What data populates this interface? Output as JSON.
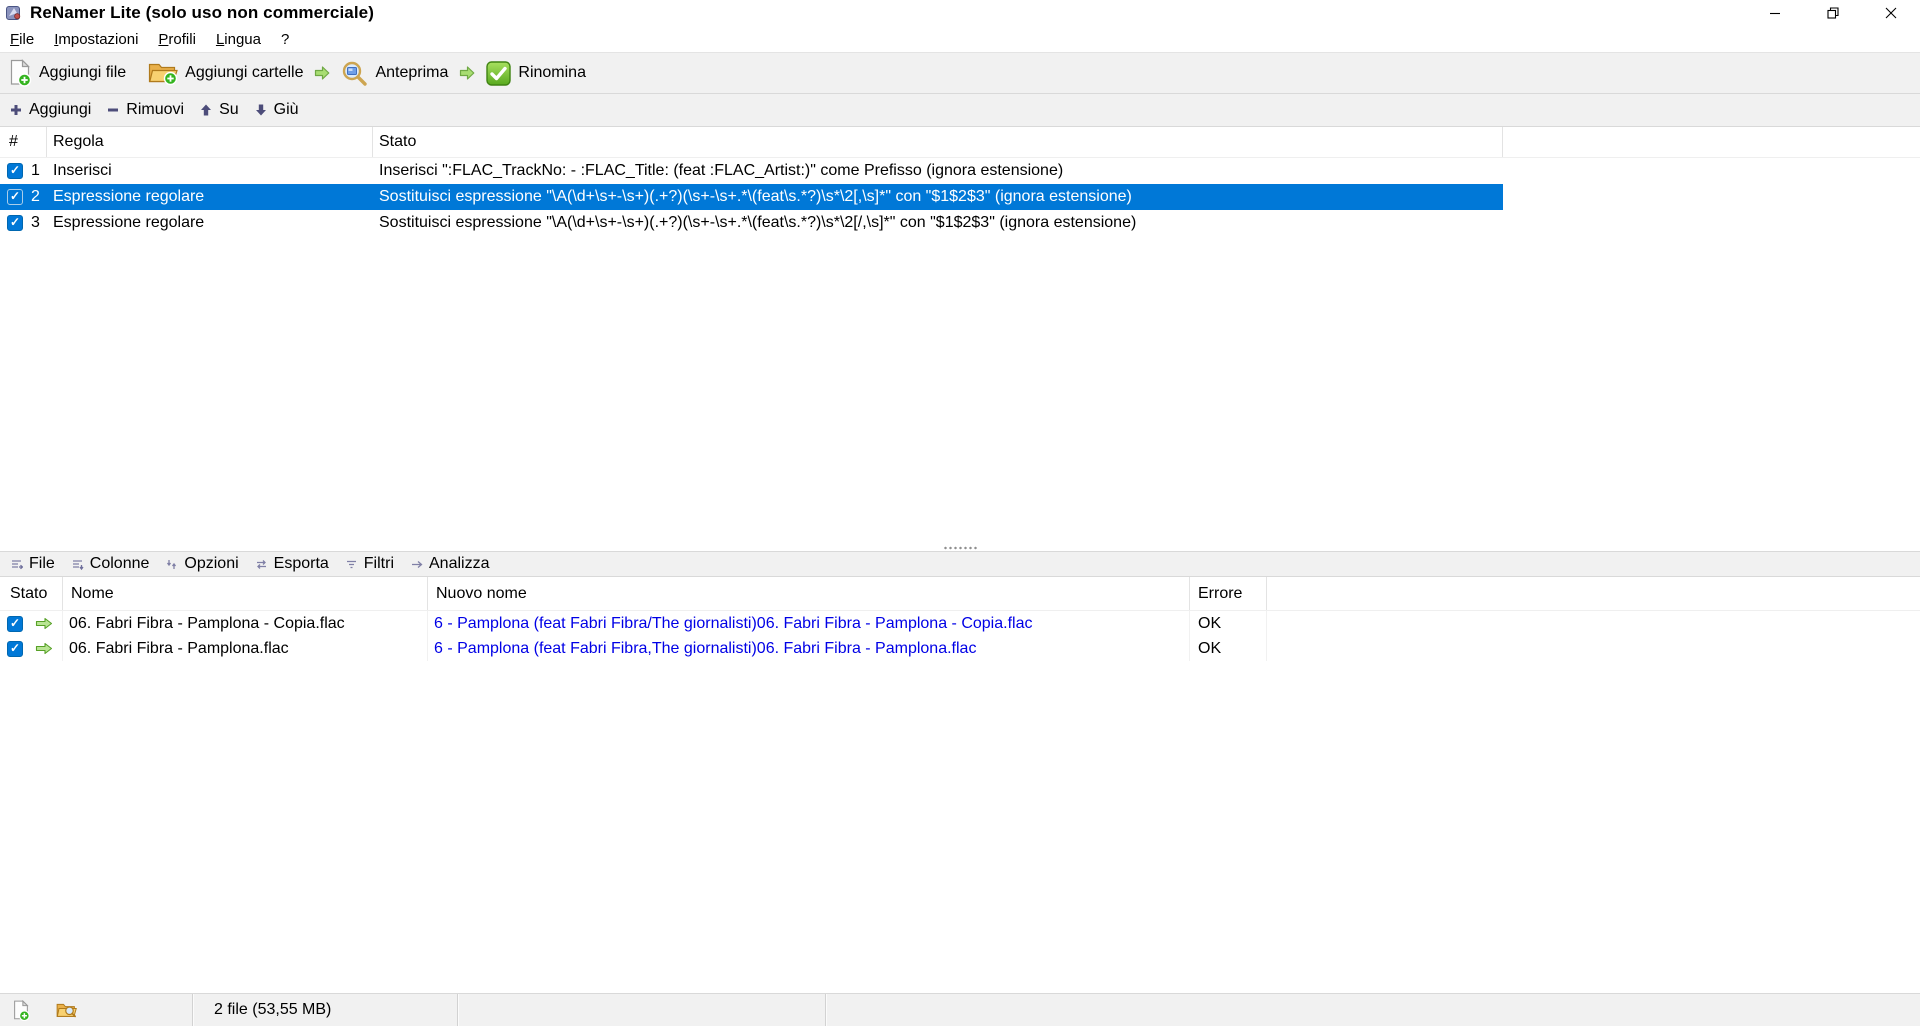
{
  "window": {
    "title": "ReNamer Lite (solo uso non commerciale)"
  },
  "menu": {
    "items": [
      "File",
      "Impostazioni",
      "Profili",
      "Lingua",
      "?"
    ]
  },
  "toolbar": {
    "add_files": "Aggiungi file",
    "add_folders": "Aggiungi cartelle",
    "preview": "Anteprima",
    "rename": "Rinomina"
  },
  "rules_toolbar": {
    "add": "Aggiungi",
    "remove": "Rimuovi",
    "up": "Su",
    "down": "Giù"
  },
  "rules_table": {
    "columns": {
      "num": "#",
      "rule": "Regola",
      "status": "Stato"
    },
    "selected_row": 2,
    "rows": [
      {
        "num": "1",
        "checked": true,
        "rule": "Inserisci",
        "status": "Inserisci \":FLAC_TrackNo: - :FLAC_Title: (feat :FLAC_Artist:)\" come Prefisso (ignora estensione)"
      },
      {
        "num": "2",
        "checked": true,
        "rule": "Espressione regolare",
        "status": "Sostituisci espressione \"\\A(\\d+\\s+-\\s+)(.+?)(\\s+-\\s+.*\\(feat\\s.*?)\\s*\\2[,\\s]*\" con \"$1$2$3\" (ignora estensione)"
      },
      {
        "num": "3",
        "checked": true,
        "rule": "Espressione regolare",
        "status": "Sostituisci espressione \"\\A(\\d+\\s+-\\s+)(.+?)(\\s+-\\s+.*\\(feat\\s.*?)\\s*\\2[/,\\s]*\" con \"$1$2$3\" (ignora estensione)"
      }
    ]
  },
  "files_toolbar": {
    "items": [
      "File",
      "Colonne",
      "Opzioni",
      "Esporta",
      "Filtri",
      "Analizza"
    ]
  },
  "files_table": {
    "columns": {
      "status": "Stato",
      "name": "Nome",
      "new_name": "Nuovo nome",
      "error": "Errore"
    },
    "rows": [
      {
        "checked": true,
        "name": "06. Fabri Fibra - Pamplona - Copia.flac",
        "new_name": "6 - Pamplona (feat Fabri Fibra/The giornalisti)06. Fabri Fibra - Pamplona - Copia.flac",
        "error": "OK"
      },
      {
        "checked": true,
        "name": "06. Fabri Fibra - Pamplona.flac",
        "new_name": "6 - Pamplona (feat Fabri Fibra,The giornalisti)06. Fabri Fibra - Pamplona.flac",
        "error": "OK"
      }
    ]
  },
  "status_bar": {
    "summary": "2 file (53,55 MB)"
  },
  "colors": {
    "selection_blue": "#0078d7",
    "new_name_blue": "#0000e6",
    "toolbar_bg": "#f1f1f1",
    "action_green": "#6db52c",
    "rule_icon_slate": "#4d4d7a"
  }
}
